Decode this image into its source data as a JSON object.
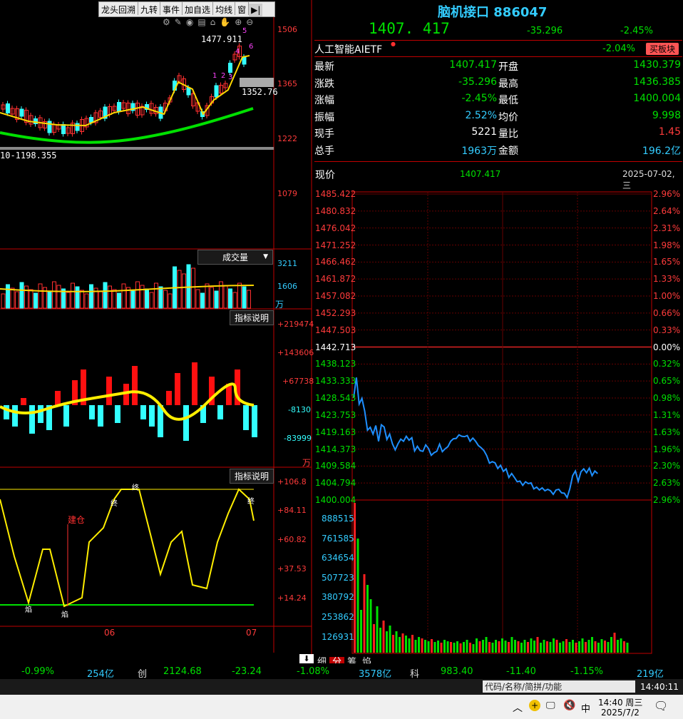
{
  "left_toolbar": {
    "items": [
      "龙头回溯",
      "九转",
      "事件",
      "加自选",
      "均线",
      "窗"
    ],
    "arrow_label": "▶|"
  },
  "kline": {
    "high_label": "1477.911",
    "low_label": "10-1198.355",
    "current_label": "1352.76",
    "axis": [
      "1506",
      "1365",
      "1222",
      "1079"
    ],
    "seq_labels": [
      "1",
      "2",
      "3",
      "4",
      "5",
      "6"
    ]
  },
  "volume_panel": {
    "title": "成交量",
    "axis": [
      "3211",
      "1606"
    ],
    "unit": "万"
  },
  "indicator1": {
    "title": "指标说明",
    "axis": [
      "+219474",
      "+143606",
      "+67738",
      "-8130",
      "-83999"
    ],
    "unit": "万"
  },
  "indicator2": {
    "title": "指标说明",
    "axis": [
      "+106.8",
      "+84.11",
      "+60.82",
      "+37.53",
      "+14.24"
    ],
    "build_label": "建仓",
    "markers": [
      "焰",
      "焰",
      "终",
      "终",
      "终"
    ]
  },
  "date_axis": [
    "06",
    "07"
  ],
  "quote": {
    "title": "脑机接口 886047",
    "price": "1407. 417",
    "change": "-35.296",
    "pct": "-2.45%",
    "etf_name": "人工智能AIETF",
    "etf_pct": "-2.04%",
    "etf_button": "买板块",
    "rows": [
      {
        "l1": "最新",
        "v1": "1407.417",
        "l2": "开盘",
        "v2": "1430.379",
        "c1": "#00e000",
        "c2": "#00e000"
      },
      {
        "l1": "涨跌",
        "v1": "-35.296",
        "l2": "最高",
        "v2": "1436.385",
        "c1": "#00e000",
        "c2": "#00e000"
      },
      {
        "l1": "涨幅",
        "v1": "-2.45%",
        "l2": "最低",
        "v2": "1400.004",
        "c1": "#00e000",
        "c2": "#00e000"
      },
      {
        "l1": "振幅",
        "v1": "2.52%",
        "l2": "均价",
        "v2": "9.998",
        "c1": "#33ccff",
        "c2": "#00e000"
      },
      {
        "l1": "现手",
        "v1": "5221",
        "l2": "量比",
        "v2": "1.45",
        "c1": "#ffffff",
        "c2": "#ff3b3b"
      },
      {
        "l1": "总手",
        "v1": "1963万",
        "l2": "金额",
        "v2": "196.2亿",
        "c1": "#33ccff",
        "c2": "#33ccff"
      }
    ]
  },
  "intraday": {
    "label": "现价",
    "price": "1407.417",
    "date": "2025-07-02,三",
    "price_axis": [
      "1485.422",
      "1480.832",
      "1476.042",
      "1471.252",
      "1466.462",
      "1461.872",
      "1457.082",
      "1452.293",
      "1447.503",
      "1442.713",
      "1438.123",
      "1433.333",
      "1428.543",
      "1423.753",
      "1419.163",
      "1414.373",
      "1409.584",
      "1404.794",
      "1400.004"
    ],
    "pct_axis": [
      "2.96%",
      "2.64%",
      "2.31%",
      "1.98%",
      "1.65%",
      "1.33%",
      "1.00%",
      "0.66%",
      "0.33%",
      "0.00%",
      "0.32%",
      "0.65%",
      "0.98%",
      "1.31%",
      "1.63%",
      "1.96%",
      "2.30%",
      "2.63%",
      "2.96%"
    ],
    "vol_axis": [
      "888515",
      "761585",
      "634654",
      "507723",
      "380792",
      "253862",
      "126931"
    ],
    "tabs": [
      "细",
      "分",
      "筹",
      "焰"
    ]
  },
  "chart_data": {
    "type": "line",
    "title": "脑机接口 886047",
    "ylim": [
      1400.004,
      1485.422
    ],
    "prev_close": 1442.713,
    "x": [
      0,
      4,
      8,
      12,
      16,
      20,
      24,
      28,
      32,
      36,
      40,
      44,
      48,
      52,
      56,
      60,
      64,
      68,
      72,
      76,
      80,
      84,
      88,
      92,
      96,
      100,
      104,
      108,
      112,
      116,
      120,
      124,
      128,
      132,
      136,
      140,
      144,
      148,
      152,
      156,
      160,
      164,
      168,
      172,
      176,
      180,
      184,
      188,
      192,
      196,
      200,
      204,
      208,
      212,
      216,
      220,
      224,
      228,
      232,
      236,
      240,
      244,
      248,
      252,
      256,
      260,
      264,
      268,
      272,
      276,
      280,
      284,
      288,
      292,
      296,
      300,
      304,
      308,
      312,
      316,
      320,
      324,
      328,
      332,
      336,
      340,
      344,
      348,
      352,
      356,
      360,
      364,
      368,
      372,
      376,
      380,
      384,
      388,
      392,
      396
    ],
    "series": [
      {
        "name": "现价",
        "values": [
          1428.5,
          1434.2,
          1426.8,
          1428.4,
          1424.8,
          1419.5,
          1420.3,
          1418.4,
          1420.8,
          1416.4,
          1421.0,
          1420.4,
          1416.9,
          1418.4,
          1415.7,
          1414.0,
          1415.7,
          1417.0,
          1416.4,
          1417.8,
          1416.7,
          1417.4,
          1413.7,
          1415.0,
          1413.8,
          1413.6,
          1415.4,
          1414.4,
          1412.5,
          1413.2,
          1413.6,
          1415.6,
          1413.5,
          1414.3,
          1414.9,
          1416.4,
          1417.1,
          1417.2,
          1418.2,
          1417.8,
          1417.7,
          1418.0,
          1416.4,
          1417.3,
          1416.4,
          1415.2,
          1414.6,
          1413.8,
          1412.4,
          1410.3,
          1410.7,
          1410.4,
          1408.8,
          1409.7,
          1408.0,
          1408.7,
          1406.3,
          1407.4,
          1406.3,
          1405.1,
          1405.3,
          1404.1,
          1405.1,
          1404.6,
          1404.8,
          1403.1,
          1403.6,
          1402.8,
          1403.4,
          1402.6,
          1403.0,
          1402.6,
          1401.6,
          1402.8,
          1403.0,
          1402.0,
          1401.9,
          1400.7,
          1403.2,
          1406.8,
          1408.1,
          1405.2,
          1407.9,
          1408.7,
          1407.6,
          1408.9,
          1406.8,
          1408.1,
          1407.4
        ]
      }
    ]
  },
  "bottom_bar": {
    "p1": "-0.99%",
    "v1": "254亿",
    "name2": "创",
    "idx2": "2124.68",
    "chg2": "-23.24",
    "p2": "-1.08%",
    "v2": "3578亿",
    "name3": "科",
    "idx3": "983.40",
    "chg3": "-11.40",
    "p3": "-1.15%",
    "v3": "219亿"
  },
  "search": {
    "placeholder": "代码/名称/简拼/功能",
    "time": "14:40:11"
  },
  "taskbar": {
    "time": "14:40 周三",
    "date": "2025/7/2",
    "ime": "中"
  },
  "colors": {
    "up": "#ff2020",
    "down": "#00e000",
    "cyan": "#33ffff",
    "price_line": "#1e8fff",
    "frame": "#c00000"
  }
}
